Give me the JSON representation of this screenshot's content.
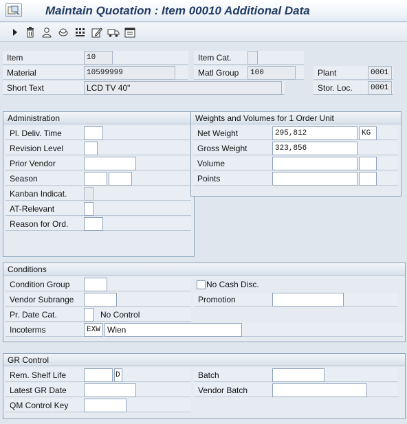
{
  "window": {
    "title": "Maintain Quotation : Item 00010 Additional Data"
  },
  "toolbar": {
    "buttons": [
      {
        "icon": "next-item-icon"
      },
      {
        "icon": "delete-icon"
      },
      {
        "icon": "vendor-icon"
      },
      {
        "icon": "services-icon"
      },
      {
        "icon": "conditions-icon"
      },
      {
        "icon": "edit-icon"
      },
      {
        "icon": "delivery-icon"
      },
      {
        "icon": "schedule-icon"
      }
    ]
  },
  "header": {
    "item_label": "Item",
    "item_value": "10",
    "item_cat_label": "Item Cat.",
    "item_cat_value": "",
    "material_label": "Material",
    "material_value": "10599999",
    "matl_group_label": "Matl Group",
    "matl_group_value": "100",
    "plant_label": "Plant",
    "plant_value": "0001",
    "short_text_label": "Short Text",
    "short_text_value": "LCD TV 40\"",
    "stor_loc_label": "Stor. Loc.",
    "stor_loc_value": "0001"
  },
  "administration": {
    "title": "Administration",
    "pl_deliv_time_label": "Pl. Deliv. Time",
    "pl_deliv_time_value": "",
    "revision_level_label": "Revision Level",
    "revision_level_value": "",
    "prior_vendor_label": "Prior Vendor",
    "prior_vendor_value": "",
    "season_label": "Season",
    "season_value_1": "",
    "season_value_2": "",
    "kanban_label": "Kanban Indicat.",
    "kanban_value": "",
    "at_relevant_label": "AT-Relevant",
    "at_relevant_value": "",
    "reason_label": "Reason for Ord.",
    "reason_value": ""
  },
  "weights": {
    "title": "Weights and Volumes for 1 Order Unit",
    "net_weight_label": "Net Weight",
    "net_weight_value": "295,812",
    "net_weight_unit": "KG",
    "gross_weight_label": "Gross Weight",
    "gross_weight_value": "323,856",
    "volume_label": "Volume",
    "volume_value": "",
    "volume_unit": "",
    "points_label": "Points",
    "points_value": "",
    "points_unit": ""
  },
  "conditions": {
    "title": "Conditions",
    "condition_group_label": "Condition Group",
    "condition_group_value": "",
    "no_cash_disc_label": "No Cash Disc.",
    "no_cash_disc_checked": false,
    "vendor_subrange_label": "Vendor Subrange",
    "vendor_subrange_value": "",
    "promotion_label": "Promotion",
    "promotion_value": "",
    "pr_date_cat_label": "Pr. Date Cat.",
    "pr_date_cat_value": "",
    "pr_date_cat_text": "No Control",
    "incoterms_label": "Incoterms",
    "incoterms_code": "EXW",
    "incoterms_place": "Wien"
  },
  "gr_control": {
    "title": "GR Control",
    "rem_shelf_life_label": "Rem. Shelf Life",
    "rem_shelf_life_value": "",
    "rem_shelf_life_unit": "D",
    "batch_label": "Batch",
    "batch_value": "",
    "latest_gr_date_label": "Latest GR Date",
    "latest_gr_date_value": "",
    "vendor_batch_label": "Vendor Batch",
    "vendor_batch_value": "",
    "qm_control_key_label": "QM Control Key",
    "qm_control_key_value": ""
  },
  "colors": {
    "title_text": "#213a62",
    "background": "#dfe6ee",
    "field_border": "#8fa3ba"
  }
}
